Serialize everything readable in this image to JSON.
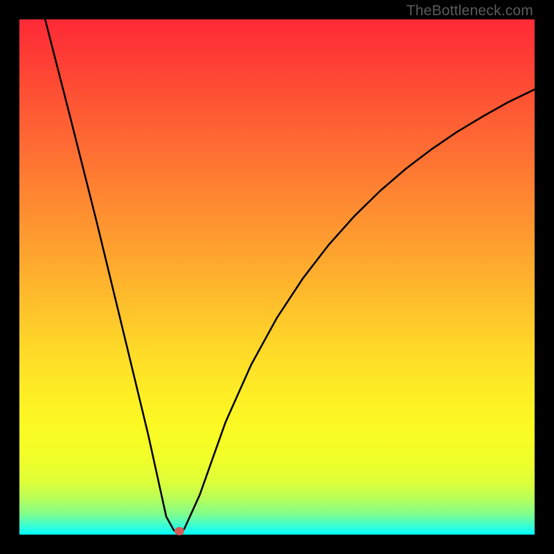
{
  "watermark": "TheBottleneck.com",
  "chart_data": {
    "type": "line",
    "title": "",
    "xlabel": "",
    "ylabel": "",
    "xlim": [
      0,
      100
    ],
    "ylim": [
      0,
      100
    ],
    "grid": false,
    "series": [
      {
        "name": "bottleneck-curve",
        "x": [
          5,
          10,
          15,
          20,
          25,
          28.5,
          30,
          31,
          32,
          35,
          40,
          45,
          50,
          55,
          60,
          65,
          70,
          75,
          80,
          85,
          90,
          95,
          100
        ],
        "values": [
          100,
          80.5,
          60.7,
          40.1,
          19.4,
          3.5,
          0.8,
          0.7,
          1.1,
          7.7,
          21.8,
          33.0,
          42.1,
          49.7,
          56.2,
          61.8,
          66.7,
          71.0,
          74.8,
          78.2,
          81.2,
          84.0,
          86.4
        ]
      }
    ],
    "minimum_marker": {
      "x": 31,
      "y": 0.7,
      "color": "#d15a57"
    },
    "gradient_stops": [
      {
        "pos": 0,
        "color": "#fe2a36"
      },
      {
        "pos": 0.5,
        "color": "#feab2e"
      },
      {
        "pos": 0.78,
        "color": "#fcf823"
      },
      {
        "pos": 0.96,
        "color": "#81fe8b"
      },
      {
        "pos": 1.0,
        "color": "#02fdfb"
      }
    ]
  }
}
